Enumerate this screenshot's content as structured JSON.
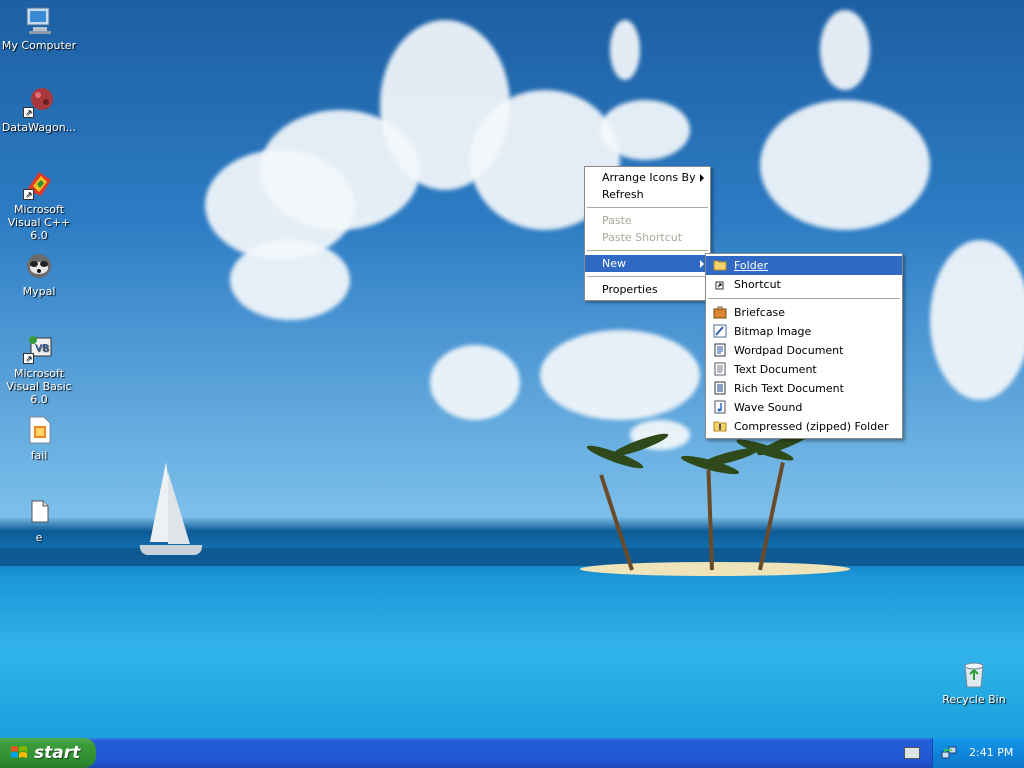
{
  "desktop": {
    "icons": [
      {
        "label": "My Computer",
        "icon": "computer-icon",
        "shortcut": false
      },
      {
        "label": "DataWagon...",
        "icon": "datawagon-icon",
        "shortcut": true
      },
      {
        "label": "Microsoft Visual C++ 6.0",
        "icon": "visual-cpp-icon",
        "shortcut": true
      },
      {
        "label": "Mypal",
        "icon": "mypal-icon",
        "shortcut": false
      },
      {
        "label": "Microsoft Visual Basic 6.0",
        "icon": "visual-basic-icon",
        "shortcut": true
      },
      {
        "label": "fail",
        "icon": "file-icon",
        "shortcut": false
      },
      {
        "label": "e",
        "icon": "blank-file-icon",
        "shortcut": false
      }
    ],
    "recycle_bin": {
      "label": "Recycle Bin",
      "icon": "recycle-bin-icon"
    }
  },
  "context_menu": {
    "items": [
      {
        "label": "Arrange Icons By",
        "submenu": true,
        "disabled": false
      },
      {
        "label": "Refresh",
        "disabled": false
      },
      {
        "label": "Paste",
        "disabled": true
      },
      {
        "label": "Paste Shortcut",
        "disabled": true
      },
      {
        "label": "New",
        "submenu": true,
        "highlighted": true
      },
      {
        "label": "Properties",
        "disabled": false
      }
    ]
  },
  "new_submenu": {
    "items": [
      {
        "label": "Folder",
        "icon": "folder-icon",
        "highlighted": true
      },
      {
        "label": "Shortcut",
        "icon": "shortcut-icon"
      },
      {
        "label": "Briefcase",
        "icon": "briefcase-icon"
      },
      {
        "label": "Bitmap Image",
        "icon": "bitmap-icon"
      },
      {
        "label": "Wordpad Document",
        "icon": "wordpad-icon"
      },
      {
        "label": "Text Document",
        "icon": "text-document-icon"
      },
      {
        "label": "Rich Text Document",
        "icon": "rich-text-icon"
      },
      {
        "label": "Wave Sound",
        "icon": "wave-sound-icon"
      },
      {
        "label": "Compressed (zipped) Folder",
        "icon": "zip-folder-icon"
      }
    ]
  },
  "taskbar": {
    "start_label": "start",
    "clock": "2:41 PM"
  },
  "colors": {
    "highlight": "#316ac5",
    "taskbar": "#245edb",
    "start_green": "#3c9d3c",
    "tray": "#0f85db"
  }
}
